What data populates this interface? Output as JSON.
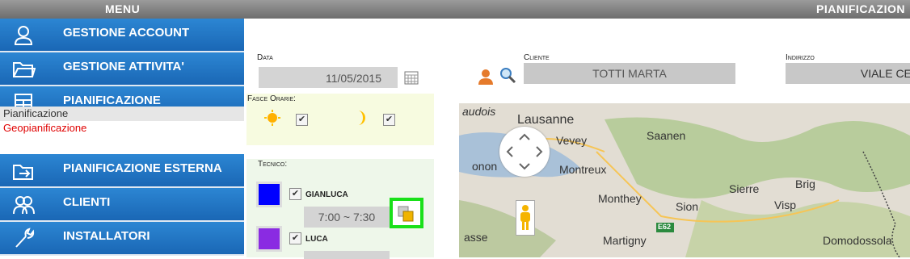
{
  "topbar": {
    "menu": "MENU",
    "right_title": "PIANIFICAZION"
  },
  "sidebar": {
    "items": [
      {
        "label": "GESTIONE ACCOUNT",
        "icon": "user-outline-icon"
      },
      {
        "label": "GESTIONE ATTIVITA'",
        "icon": "folder-icon"
      },
      {
        "label": "PIANIFICAZIONE",
        "icon": "planning-grid-icon"
      },
      {
        "label": "PIANIFICAZIONE ESTERNA",
        "icon": "external-folder-icon"
      },
      {
        "label": "CLIENTI",
        "icon": "users-icon"
      },
      {
        "label": "INSTALLATORI",
        "icon": "wrench-icon"
      }
    ],
    "sub_items": [
      "Pianificazione",
      "Geopianificazione"
    ]
  },
  "form": {
    "data_label": "Data",
    "date_value": "11/05/2015",
    "fasce_label": "Fasce Orarie:",
    "tecnico_label": "Tecnico:",
    "technicians": [
      {
        "name": "GIANLUCA",
        "color": "#0000ff",
        "time": "7:00 ~ 7:30"
      },
      {
        "name": "LUCA",
        "color": "#8a2be2"
      }
    ]
  },
  "cliente": {
    "label": "Cliente",
    "value": "TOTTI MARTA"
  },
  "indirizzo": {
    "label": "Indirizzo",
    "value": "VIALE CER"
  },
  "map": {
    "towns": [
      "audois",
      "Lausanne",
      "Vevey",
      "Saanen",
      "Montreux",
      "onon",
      "Monthey",
      "Sion",
      "Sierre",
      "Brig",
      "Visp",
      "asse",
      "Martigny",
      "Domodossola"
    ],
    "road": "E62"
  },
  "colors": {
    "nav_blue": "#1f73c4",
    "highlight_green": "#19e019",
    "link_red": "#e00000"
  }
}
